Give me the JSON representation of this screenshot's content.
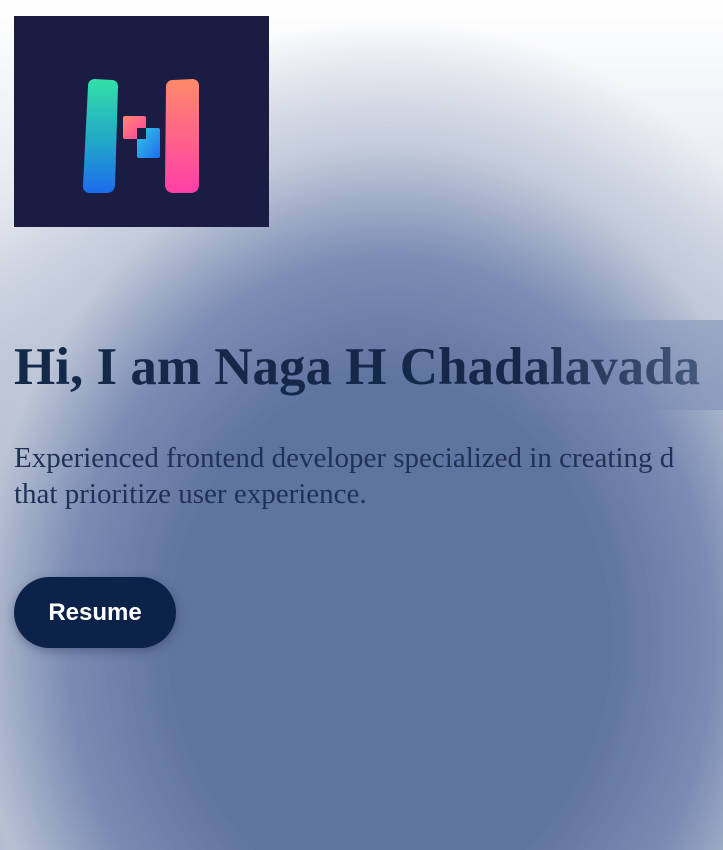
{
  "logo": {
    "name": "H logo",
    "background": "#1b1c44",
    "colors": [
      "#34e0a8",
      "#1d6cf0",
      "#ff8a6a",
      "#ff3fa8"
    ]
  },
  "hero": {
    "title": "Hi, I am Naga H Chadalavada",
    "description": "Experienced frontend developer specialized in creating d that prioritize user experience.",
    "description_line1": "Experienced frontend developer specialized in creating d",
    "description_line2": "that prioritize user experience.",
    "title_color": "#14284a"
  },
  "actions": {
    "resume_label": "Resume",
    "resume_bg": "#0d2249"
  }
}
